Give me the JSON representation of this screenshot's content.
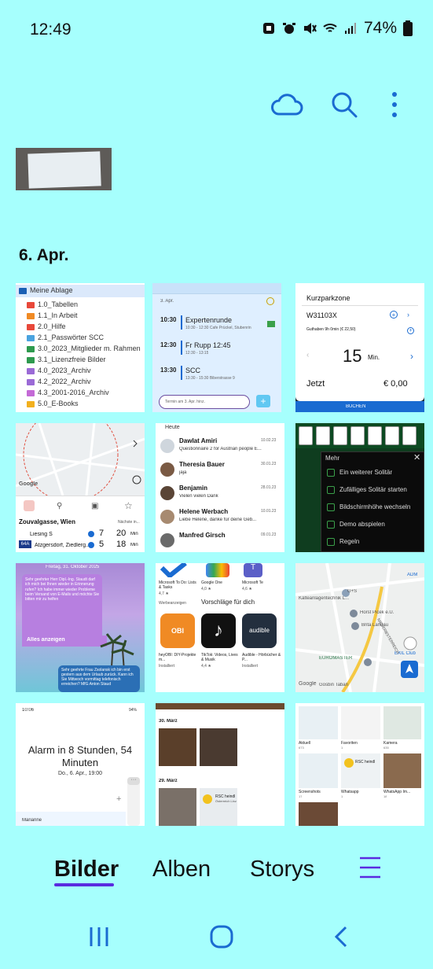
{
  "status": {
    "time": "12:49",
    "battery": "74%"
  },
  "section": {
    "date": "6. Apr."
  },
  "tile1": {
    "root": "Meine Ablage",
    "folders": [
      {
        "name": "1.0_Tabellen",
        "color": "#e8483a"
      },
      {
        "name": "1.1_In Arbeit",
        "color": "#f08a24"
      },
      {
        "name": "2.0_Hilfe",
        "color": "#e8483a"
      },
      {
        "name": "2.1_Passwörter SCC",
        "color": "#4aa3df"
      },
      {
        "name": "3.0_2023_Mitglieder m. Rahmen",
        "color": "#2e9a4e"
      },
      {
        "name": "3.1_Lizenzfreie Bilder",
        "color": "#2e9a4e"
      },
      {
        "name": "4.0_2023_Archiv",
        "color": "#9b6ad6"
      },
      {
        "name": "4.2_2022_Archiv",
        "color": "#9b6ad6"
      },
      {
        "name": "4.3_2001-2016_Archiv",
        "color": "#c46ad6"
      },
      {
        "name": "5.0_E-Books",
        "color": "#f2b01e"
      }
    ]
  },
  "tile2": {
    "day": "3. Apr.",
    "events": [
      {
        "time": "10:30",
        "title": "Expertenrunde",
        "detail": "10:30 - 12:30 Cafe Prückel, Stubenrin"
      },
      {
        "time": "12:30",
        "title": "Fr Rupp 12:45",
        "detail": "12:30 - 13:15"
      },
      {
        "time": "13:30",
        "title": "SCC",
        "detail": "13:30 - 15:30 Biberstrasse 9"
      }
    ],
    "input_placeholder": "Termin am 3. Apr. hinz."
  },
  "tile3": {
    "zone": "Kurzparkzone",
    "plate": "W31103X",
    "credit": "Guthaben 9h 0min (€ 22,50)",
    "minutes": "15",
    "min_label": "Min.",
    "now": "Jetzt",
    "price": "€ 0,00",
    "buy": "BUCHEN"
  },
  "tile4": {
    "street": "Zouvalgasse, Wien",
    "next": "Nächste in...",
    "rows": [
      {
        "line": "",
        "stop": "Liesing S",
        "a": "7",
        "b": "20",
        "unit": "Min"
      },
      {
        "line": "64A",
        "stop": "Atzgersdorf, Ziedlerg..",
        "a": "5",
        "b": "18",
        "unit": "Min"
      }
    ],
    "google": "Google"
  },
  "tile5": {
    "top": "Heute",
    "mails": [
      {
        "name": "Dawlat Amiri",
        "date": "10.02.23",
        "text": "Questionnaire 2 for Austrian people E..."
      },
      {
        "name": "Theresia Bauer",
        "date": "30.01.23",
        "text": "jaja"
      },
      {
        "name": "Benjamin",
        "date": "28.01.23",
        "text": "Vielen vielen Dank"
      },
      {
        "name": "Helene Werbach",
        "date": "10.01.23",
        "text": "Liebe Helene,  danke für deine Geb..."
      },
      {
        "name": "Manfred Girsch",
        "date": "09.01.23",
        "text": ""
      }
    ]
  },
  "tile6": {
    "menu_title": "Mehr",
    "items": [
      "Ein weiterer Solitär",
      "Zufälliges Solitär starten",
      "Bildschirmhöhe wechseln",
      "Demo abspielen",
      "Regeln"
    ]
  },
  "tile7": {
    "header": "Freitag, 31. Oktober 2025",
    "bubble": "Sehr geehrter Herr Dipl.-Ing. Staudt darf ich mich bei Ihnen wieder in Erinnerung rufen? Ich habe immer wieder Probleme beim Versand von E-Mails und möchte Sie bitten mir zu helfen",
    "show_all": "Alles anzeigen",
    "bubble2": "Sehr geehrte Frau Zsolansk ich bin erst gestern aus dem Urlaub zurück. Kann ich Sie Mittwoch vormittag telefonisch erreichen? MfG Anton Staud"
  },
  "tile8": {
    "apps": [
      {
        "name": "Microsoft To Do: Lists & Tasks",
        "rating": "4,7 ★"
      },
      {
        "name": "Google One",
        "rating": "4,0 ★"
      },
      {
        "name": "Microsoft Te",
        "rating": "4,6 ★"
      }
    ],
    "ads": "Werbeanzeigen",
    "suggest": "Vorschläge für dich",
    "apps2": [
      {
        "name": "heyOBI: DIY-Projekte m...",
        "status": "Installiert"
      },
      {
        "name": "TikTok: Videos, Lives & Musik",
        "status": "4,4 ★"
      },
      {
        "name": "Audible - Hörbücher & P...",
        "status": "Installiert"
      }
    ]
  },
  "tile9": {
    "labels": [
      "Kälteanlagentechnik L...",
      "G+S",
      "Horst Picek e.U.",
      "Brita Landau",
      "EUROMASTER",
      "EXIL Club",
      "ADM",
      "Google",
      "NIEDERBSTERREICH",
      "Gosbin Tabān"
    ]
  },
  "tile10": {
    "time": "10:06",
    "batt": "94%",
    "title": "Alarm in 8 Stunden, 54 Minuten",
    "sub": "Do., 6. Apr., 19:00",
    "name": "Marianne"
  },
  "tile11": {
    "d1": "30. März",
    "d2": "29. März",
    "card": "RSC heindl",
    "card_sub": "Österreich Linz"
  },
  "tile12": {
    "albums": [
      {
        "name": "Aktuell",
        "count": "673"
      },
      {
        "name": "Favoriten",
        "count": "1"
      },
      {
        "name": "Kamera",
        "count": "635"
      },
      {
        "name": "Screenshots",
        "count": "17"
      },
      {
        "name": "Whatsapp",
        "count": "1"
      },
      {
        "name": "WhatsApp Im...",
        "count": "18"
      }
    ],
    "card": "RSC heindl"
  },
  "nav": {
    "bilder": "Bilder",
    "alben": "Alben",
    "storys": "Storys"
  },
  "colors": {
    "accent": "#1a6bd1",
    "active_underline": "#5a2be0",
    "background": "#a6fffd"
  }
}
